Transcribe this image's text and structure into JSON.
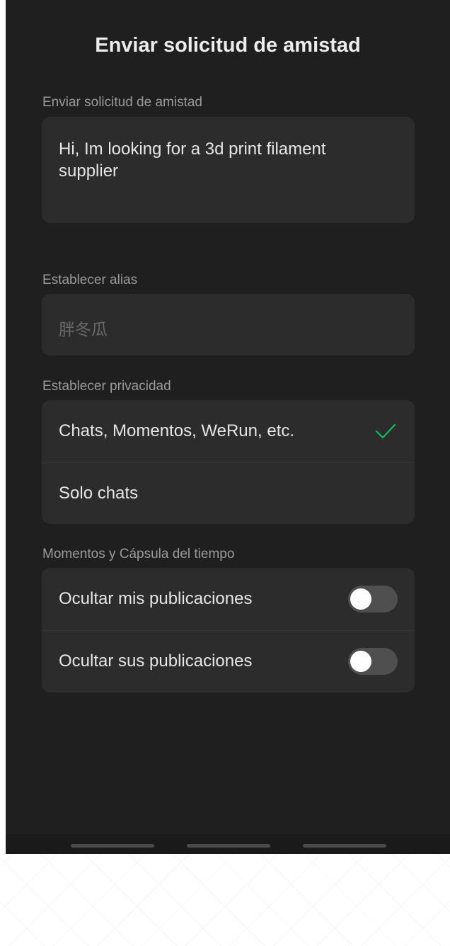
{
  "header": {
    "title": "Enviar solicitud de amistad"
  },
  "message": {
    "label": "Enviar solicitud de amistad",
    "value": "Hi, Im looking for a 3d print filament supplier"
  },
  "alias": {
    "label": "Establecer alias",
    "placeholder": "胖冬瓜"
  },
  "privacy": {
    "label": "Establecer privacidad",
    "options": [
      {
        "label": "Chats, Momentos, WeRun, etc.",
        "selected": true
      },
      {
        "label": "Solo chats",
        "selected": false
      }
    ]
  },
  "moments": {
    "label": "Momentos y Cápsula del tiempo",
    "toggles": [
      {
        "label": "Ocultar mis publicaciones",
        "on": false
      },
      {
        "label": "Ocultar sus publicaciones",
        "on": false
      }
    ]
  },
  "colors": {
    "background": "#1f1f1f",
    "card": "#2c2c2c",
    "check": "#07c160",
    "toggle_off": "#4f4f4f"
  }
}
